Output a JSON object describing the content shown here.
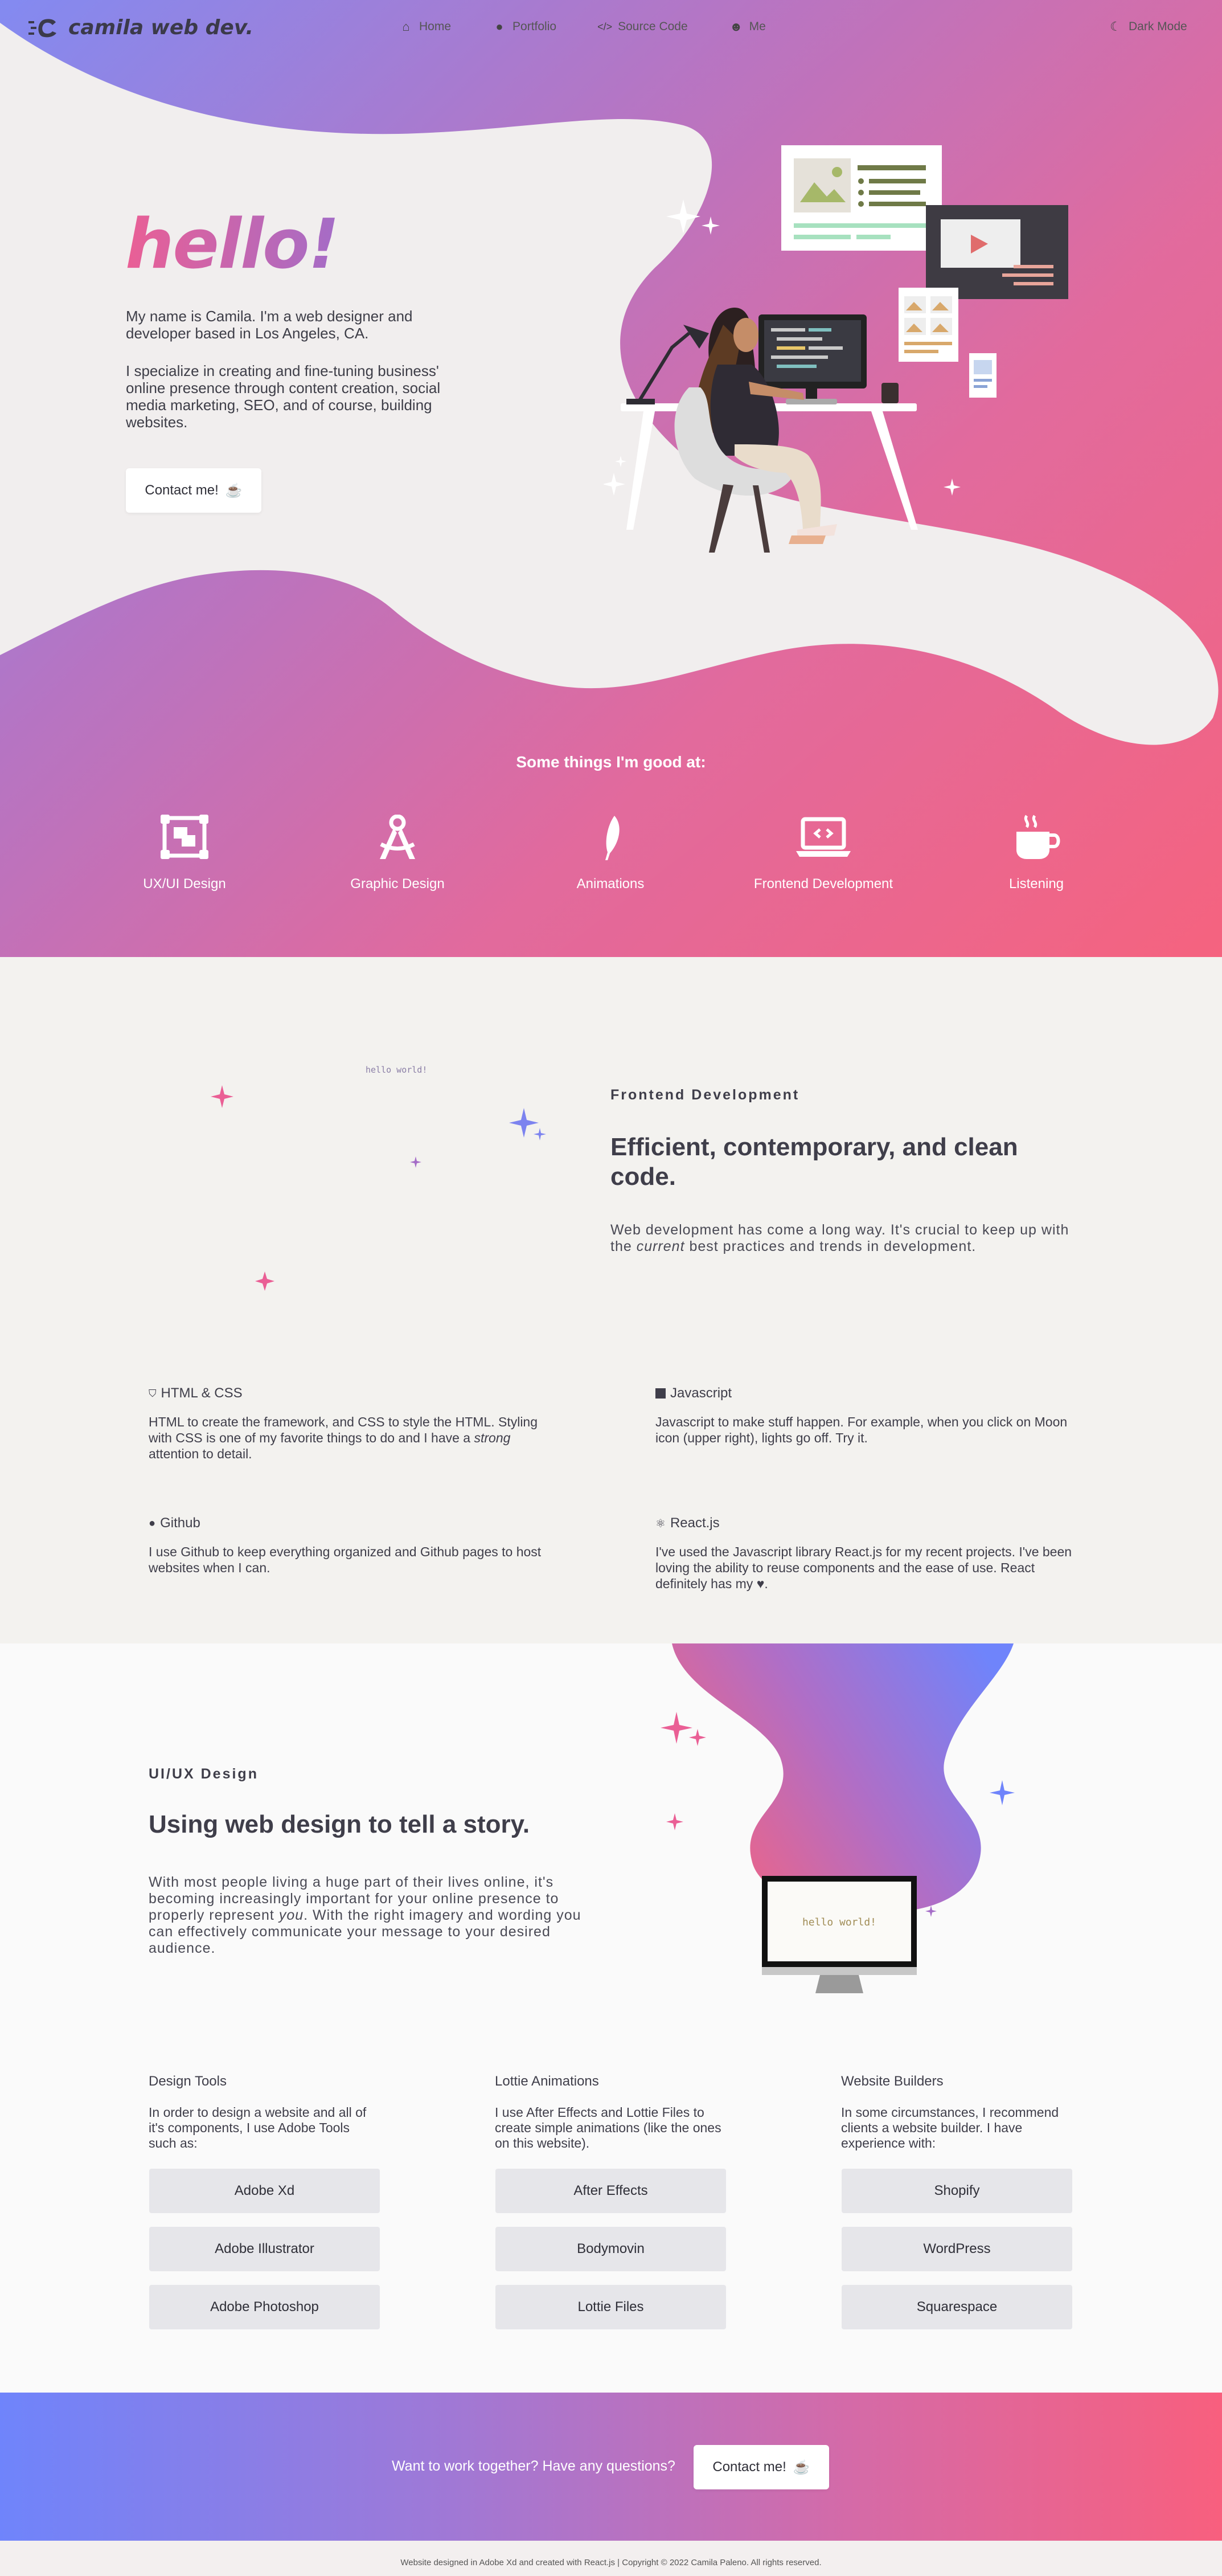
{
  "nav": {
    "logo_text": "camila web dev.",
    "links": [
      {
        "label": "Home",
        "icon": "home-icon"
      },
      {
        "label": "Portfolio",
        "icon": "palette-icon"
      },
      {
        "label": "Source Code",
        "icon": "code-icon"
      },
      {
        "label": "Me",
        "icon": "smiley-icon"
      }
    ],
    "dark_mode_label": "Dark Mode"
  },
  "hero": {
    "greeting": "hello!",
    "intro": "My name is Camila. I'm a web designer and developer based in Los Angeles, CA.",
    "specialty": "I specialize in creating and fine-tuning business' online presence through content creation, social media marketing, SEO, and of course, building websites.",
    "contact_label": "Contact me!"
  },
  "skills": {
    "title": "Some things I'm good at:",
    "items": [
      {
        "label": "UX/UI Design",
        "icon": "layout-icon"
      },
      {
        "label": "Graphic Design",
        "icon": "compass-icon"
      },
      {
        "label": "Animations",
        "icon": "feather-icon"
      },
      {
        "label": "Frontend Development",
        "icon": "laptop-code-icon"
      },
      {
        "label": "Listening",
        "icon": "coffee-icon"
      }
    ]
  },
  "frontend": {
    "label": "Frontend Development",
    "title": "Efficient, contemporary, and clean code.",
    "p_before": "Web development has come a long way. It's crucial to keep up with the ",
    "p_em": "current",
    "p_after": " best practices and trends in development.",
    "code_text": "hello world!",
    "features": [
      {
        "title": "HTML & CSS",
        "icon": "html5-icon",
        "text_a": "HTML to create the framework, and CSS to style the HTML. Styling with CSS is one of my favorite things to do and I have a ",
        "text_em": "strong",
        "text_b": " attention to detail."
      },
      {
        "title": "Javascript",
        "icon": "js-icon",
        "text_a": "Javascript to make stuff happen. For example, when you click on Moon icon (upper right), lights go off. Try it.",
        "text_em": "",
        "text_b": ""
      },
      {
        "title": "Github",
        "icon": "github-icon",
        "text_a": "I use Github to keep everything organized and Github pages to host websites when I can.",
        "text_em": "",
        "text_b": ""
      },
      {
        "title": "React.js",
        "icon": "react-icon",
        "text_a": "I've used the Javascript library React.js for my recent projects. I've been loving the ability to reuse components and the ease of use. React definitely has my ",
        "text_em": "",
        "text_b": "."
      }
    ]
  },
  "uiux": {
    "label": "UI/UX Design",
    "title": "Using web design to tell a story.",
    "p_before": "With most people living a huge part of their lives online, it's becoming increasingly important for your online presence to properly represent ",
    "p_em": "you",
    "p_after": ". With the right imagery and wording you can effectively communicate your message to your desired audience.",
    "monitor_text": "hello world!",
    "columns": [
      {
        "title": "Design Tools",
        "text": "In order to design a website and all of it's components, I use Adobe Tools such as:",
        "items": [
          "Adobe Xd",
          "Adobe Illustrator",
          "Adobe Photoshop"
        ]
      },
      {
        "title": "Lottie Animations",
        "text": "I use After Effects and Lottie Files to create simple animations (like the ones on this website).",
        "items": [
          "After Effects",
          "Bodymovin",
          "Lottie Files"
        ]
      },
      {
        "title": "Website Builders",
        "text": "In some circumstances, I recommend clients a website builder. I have experience with:",
        "items": [
          "Shopify",
          "WordPress",
          "Squarespace"
        ]
      }
    ]
  },
  "cta": {
    "text": "Want to work together? Have any questions?",
    "button_label": "Contact me!"
  },
  "footer": {
    "text": "Website designed in Adobe Xd and created with React.js | Copyright © 2022 Camila Paleno. All rights reserved."
  },
  "colors": {
    "pink": "#f5637f",
    "purple": "#b46fc0",
    "blue": "#7b83f0",
    "dark_text": "#3f3e4a",
    "light_bg": "#f3f2ef"
  }
}
